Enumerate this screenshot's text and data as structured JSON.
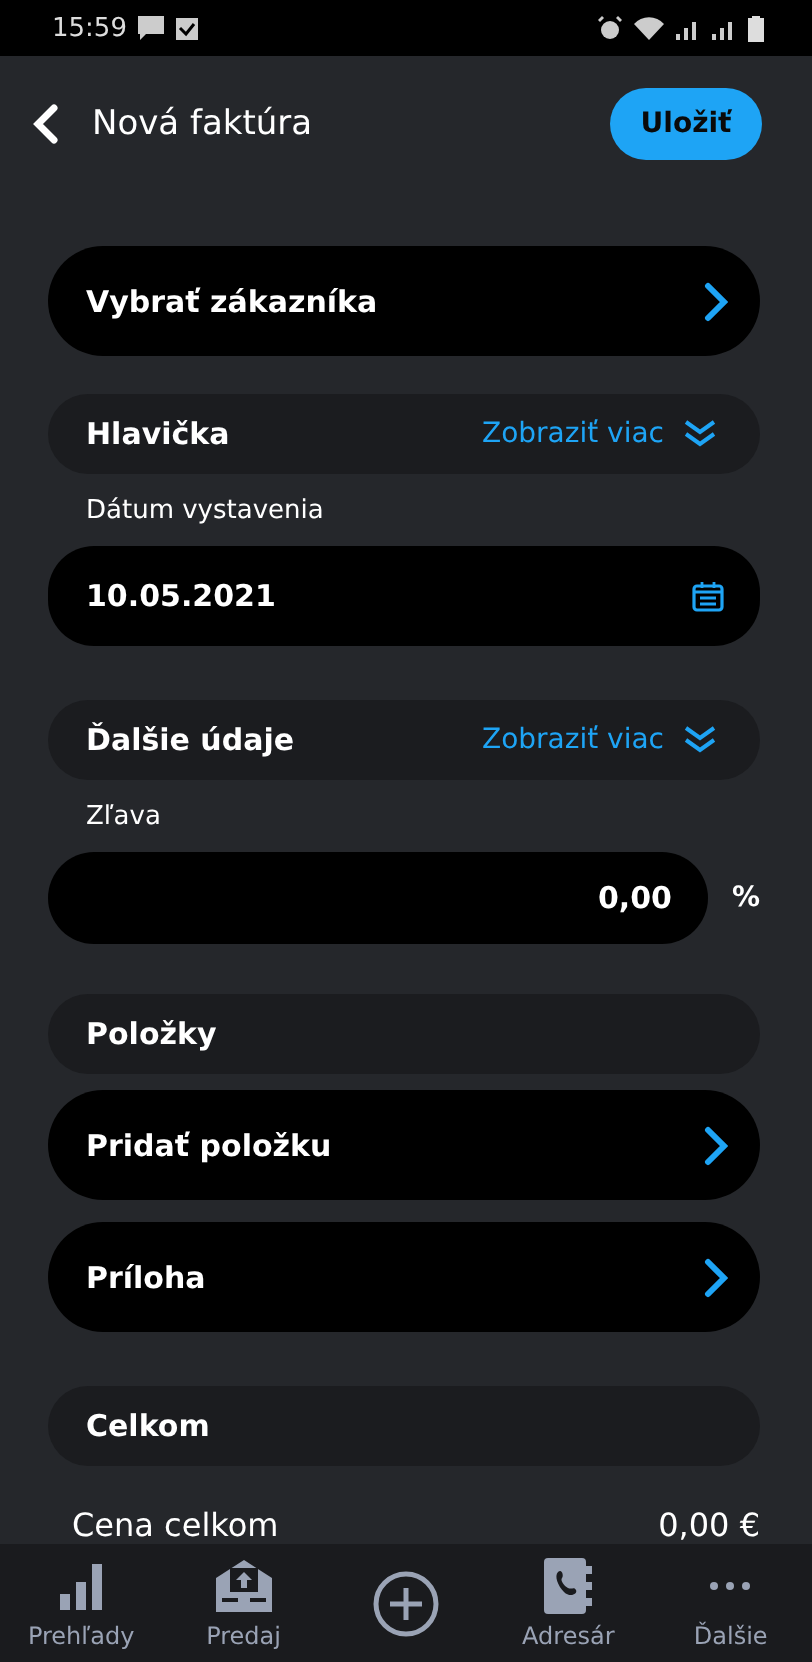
{
  "status_bar": {
    "time": "15:59"
  },
  "header": {
    "title": "Nová faktúra",
    "save_button": "Uložiť"
  },
  "customer_row": {
    "label": "Vybrať zákazníka"
  },
  "header_section": {
    "title": "Hlavička",
    "toggle": "Zobraziť viac",
    "date_label": "Dátum vystavenia",
    "date_value": "10.05.2021"
  },
  "extra_section": {
    "title": "Ďalšie údaje",
    "toggle": "Zobraziť viac",
    "discount_label": "Zľava",
    "discount_value": "0,00",
    "discount_unit": "%"
  },
  "items_section": {
    "title": "Položky",
    "rows": [
      {
        "label": "Pridať položku"
      },
      {
        "label": "Príloha"
      }
    ]
  },
  "total_section": {
    "title": "Celkom",
    "total_label": "Cena celkom",
    "total_value": "0,00 €"
  },
  "bottom_nav": [
    {
      "kind": "chart",
      "label": "Prehľady"
    },
    {
      "kind": "sales",
      "label": "Predaj"
    },
    {
      "kind": "add"
    },
    {
      "kind": "contacts",
      "label": "Adresár"
    },
    {
      "kind": "more",
      "label": "Ďalšie"
    }
  ]
}
